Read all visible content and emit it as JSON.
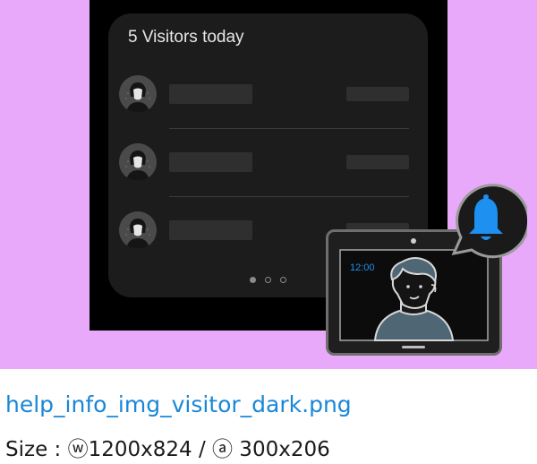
{
  "widget": {
    "title": "5 Visitors today"
  },
  "visitors": [
    {
      "avatar_icon": "person-icon"
    },
    {
      "avatar_icon": "person-icon"
    },
    {
      "avatar_icon": "person-icon"
    }
  ],
  "pagination": {
    "current": 1,
    "total": 3
  },
  "intercom": {
    "time": "12:00",
    "screen_icon": "visitor-face-icon"
  },
  "notification": {
    "icon": "bell-icon",
    "color": "#1e90f0"
  },
  "caption": {
    "filename": "help_info_img_visitor_dark.png",
    "size": "Size : ⓦ1200x824 / ⓐ 300x206"
  },
  "colors": {
    "background": "#e8a9fa",
    "card": "#1c1c1c",
    "link": "#1a87d6"
  }
}
